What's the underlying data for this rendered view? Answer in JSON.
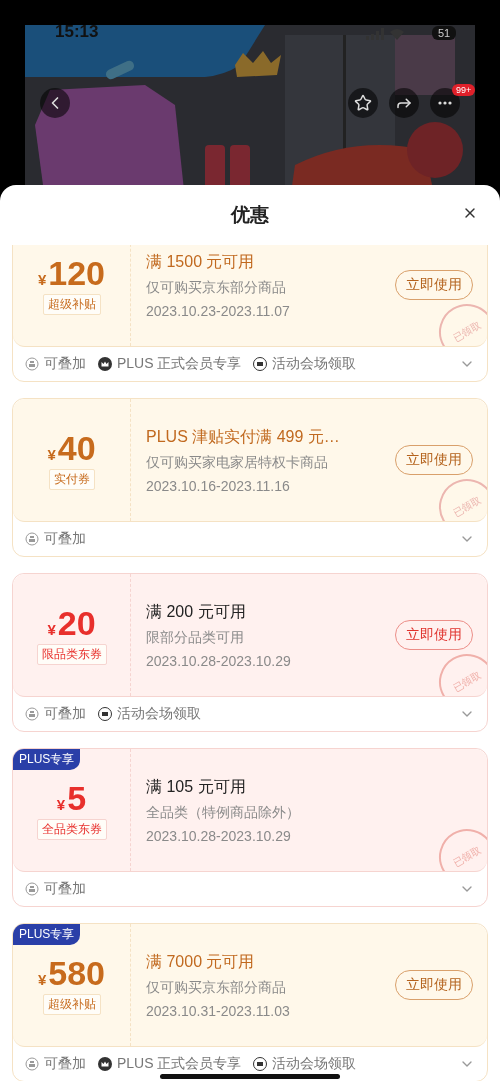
{
  "status_bar": {
    "time": "15:13",
    "battery": "51"
  },
  "nav": {
    "more_badge": "99+"
  },
  "sheet": {
    "title": "优惠"
  },
  "coupons": [
    {
      "kind": "gold",
      "amount": "120",
      "currency": "¥",
      "type_label": "超级补贴",
      "title": "满 1500 元可用",
      "scope": "仅可购买京东部分商品",
      "period": "2023.10.23-2023.11.07",
      "button": "立即使用",
      "stamp": "已领取",
      "features": [
        {
          "kind": "stack",
          "label": "可叠加"
        },
        {
          "kind": "crown",
          "label": "PLUS 正式会员专享"
        },
        {
          "kind": "venue",
          "label": "活动会场领取"
        }
      ]
    },
    {
      "kind": "gold",
      "amount": "40",
      "currency": "¥",
      "type_label": "实付券",
      "title": "PLUS 津贴实付满 499 元…",
      "scope": "仅可购买家电家居特权卡商品",
      "period": "2023.10.16-2023.11.16",
      "button": "立即使用",
      "stamp": "已领取",
      "features": [
        {
          "kind": "stack",
          "label": "可叠加"
        }
      ]
    },
    {
      "kind": "red",
      "amount": "20",
      "currency": "¥",
      "type_label": "限品类东券",
      "title": "满 200 元可用",
      "scope": "限部分品类可用",
      "period": "2023.10.28-2023.10.29",
      "button": "立即使用",
      "stamp": "已领取",
      "features": [
        {
          "kind": "stack",
          "label": "可叠加"
        },
        {
          "kind": "venue",
          "label": "活动会场领取"
        }
      ]
    },
    {
      "kind": "red",
      "tag": "PLUS专享",
      "amount": "5",
      "currency": "¥",
      "type_label": "全品类东券",
      "title": "满 105 元可用",
      "scope": "全品类（特例商品除外）",
      "period": "2023.10.28-2023.10.29",
      "stamp": "已领取",
      "features": [
        {
          "kind": "stack",
          "label": "可叠加"
        }
      ]
    },
    {
      "kind": "gold",
      "tag": "PLUS专享",
      "amount": "580",
      "currency": "¥",
      "type_label": "超级补贴",
      "title": "满 7000 元可用",
      "scope": "仅可购买京东部分商品",
      "period": "2023.10.31-2023.11.03",
      "button": "立即使用",
      "features": [
        {
          "kind": "stack",
          "label": "可叠加"
        },
        {
          "kind": "crown",
          "label": "PLUS 正式会员专享"
        },
        {
          "kind": "venue",
          "label": "活动会场领取"
        }
      ]
    }
  ]
}
